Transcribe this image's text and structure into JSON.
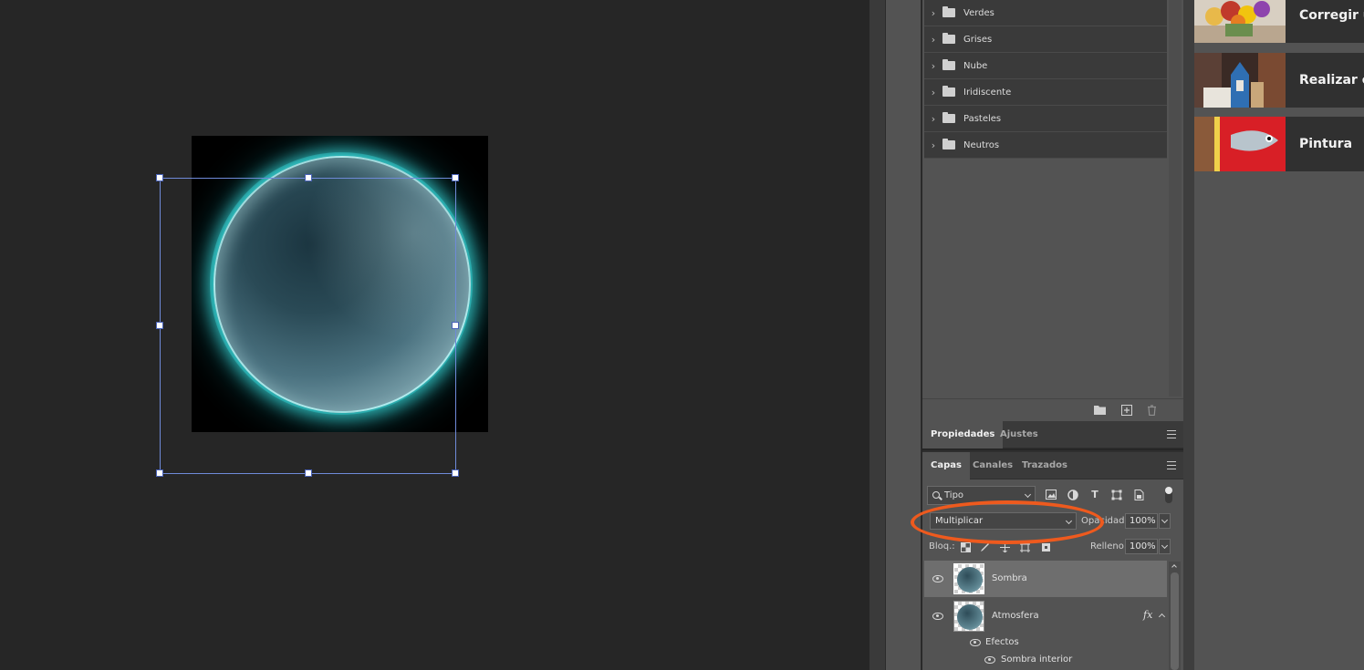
{
  "swatches": {
    "groups": [
      {
        "label": "Verdes"
      },
      {
        "label": "Grises"
      },
      {
        "label": "Nube"
      },
      {
        "label": "Iridiscente"
      },
      {
        "label": "Pasteles"
      },
      {
        "label": "Neutros"
      }
    ]
  },
  "properties_tabs": {
    "tab1": "Propiedades",
    "tab2": "Ajustes"
  },
  "layers_tabs": {
    "tab1": "Capas",
    "tab2": "Canales",
    "tab3": "Trazados"
  },
  "layers": {
    "filter_label": "Tipo",
    "blend_mode": "Multiplicar",
    "opacity_label": "Opacidad:",
    "opacity_value": "100%",
    "lock_label": "Bloq.:",
    "fill_label": "Relleno:",
    "fill_value": "100%",
    "items": [
      {
        "name": "Sombra",
        "selected": true
      },
      {
        "name": "Atmosfera",
        "fx": "fx"
      }
    ],
    "effects_label": "Efectos",
    "effect_item": "Sombra interior"
  },
  "tutorials": [
    {
      "title": "Corregir un"
    },
    {
      "title": "Realizar efe"
    },
    {
      "title": "Pintura"
    }
  ],
  "colors": {
    "highlight": "#ee5a1e",
    "transform_box": "#6f8ad8",
    "glow": "#46e6e6"
  }
}
